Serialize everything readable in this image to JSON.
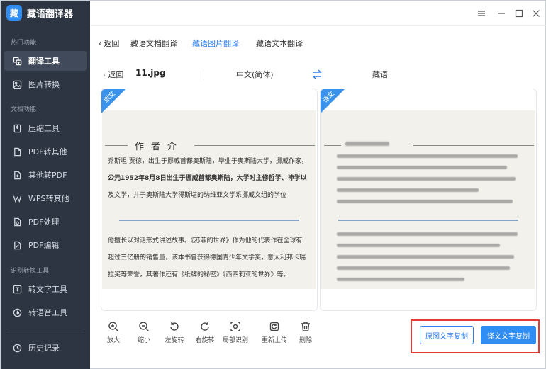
{
  "app": {
    "title": "藏语翻译器",
    "logo_char": "藏"
  },
  "sidebar": {
    "sections": [
      {
        "label": "热门功能"
      },
      {
        "label": "文档功能"
      },
      {
        "label": "识别转换工具"
      }
    ],
    "items": [
      {
        "label": "翻译工具",
        "icon": "translate-icon",
        "active": true
      },
      {
        "label": "图片转换",
        "icon": "image-convert-icon"
      },
      {
        "label": "压缩工具",
        "icon": "compress-icon"
      },
      {
        "label": "PDF转其他",
        "icon": "pdf-icon"
      },
      {
        "label": "其他转PDF",
        "icon": "to-pdf-icon"
      },
      {
        "label": "WPS转其他",
        "icon": "wps-icon"
      },
      {
        "label": "PDF处理",
        "icon": "pdf-process-icon"
      },
      {
        "label": "PDF编辑",
        "icon": "pdf-edit-icon"
      },
      {
        "label": "转文字工具",
        "icon": "text-icon"
      },
      {
        "label": "转语音工具",
        "icon": "voice-icon"
      },
      {
        "label": "历史记录",
        "icon": "history-icon"
      }
    ]
  },
  "tabs": {
    "back_label": "返回",
    "items": [
      {
        "label": "藏语文档翻译",
        "active": false
      },
      {
        "label": "藏语图片翻译",
        "active": true
      },
      {
        "label": "藏语文本翻译",
        "active": false
      }
    ]
  },
  "file": {
    "back_label": "返回",
    "name": "11.jpg",
    "source_lang": "中文(简体)",
    "target_lang": "藏语"
  },
  "panels": {
    "source_corner": "原文",
    "target_corner": "译文",
    "doc_title": "作者介",
    "doc_lines": [
      "乔斯坦·贾德，出生于挪威首都奥斯陆，毕业于奥斯陆大学，挪威作家，",
      "公元1952年8月8日出生于挪威首都奥斯陆，大学时主修哲学、神学以",
      "及文学，并于奥斯陆大学得斯堪的纳维亚文学系挪威文组的学位",
      "他擅长以对话形式讲述故事。《苏菲的世界》作为他的代表作在全球有",
      "超过三亿册的销售量，该本书曾获得德国青少年文学奖，意大利邦卡瑞",
      "拉奖等荣誉，其著作还有《纸牌的秘密》《西西莉亚的世界》等。"
    ]
  },
  "toolbar": [
    {
      "label": "放大",
      "icon": "zoom-in-icon"
    },
    {
      "label": "缩小",
      "icon": "zoom-out-icon"
    },
    {
      "label": "左旋转",
      "icon": "rotate-left-icon"
    },
    {
      "label": "右旋转",
      "icon": "rotate-right-icon"
    },
    {
      "label": "局部识别",
      "icon": "partial-recognize-icon"
    },
    {
      "label": "重新上传",
      "icon": "reupload-icon"
    },
    {
      "label": "删除",
      "icon": "delete-icon"
    }
  ],
  "actions": {
    "copy_source": "原图文字复制",
    "copy_target": "译文文字复制"
  },
  "colors": {
    "accent": "#2f7fef",
    "sidebar": "#2d3542",
    "highlight": "#e23b35"
  }
}
